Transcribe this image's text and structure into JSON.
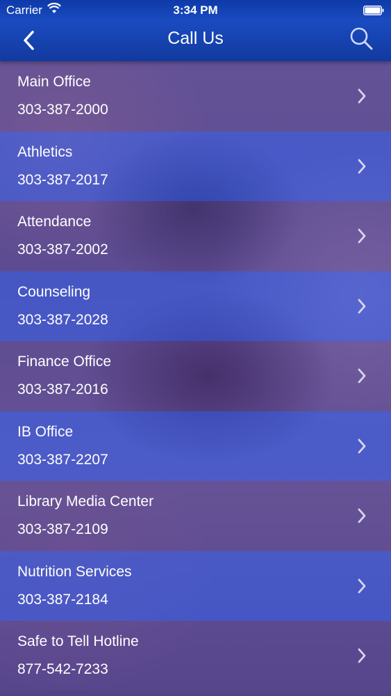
{
  "status_bar": {
    "carrier": "Carrier",
    "time": "3:34 PM"
  },
  "nav": {
    "title": "Call Us",
    "back_icon": "chevron-left-icon",
    "search_icon": "search-icon"
  },
  "contacts": [
    {
      "name": "Main Office",
      "phone": "303-387-2000"
    },
    {
      "name": "Athletics",
      "phone": "303-387-2017"
    },
    {
      "name": "Attendance",
      "phone": "303-387-2002"
    },
    {
      "name": "Counseling",
      "phone": "303-387-2028"
    },
    {
      "name": "Finance Office",
      "phone": "303-387-2016"
    },
    {
      "name": "IB Office",
      "phone": "303-387-2207"
    },
    {
      "name": "Library Media Center",
      "phone": "303-387-2109"
    },
    {
      "name": "Nutrition Services",
      "phone": "303-387-2184"
    },
    {
      "name": "Safe to Tell Hotline",
      "phone": "877-542-7233"
    }
  ],
  "colors": {
    "nav_bar": "#1a4bc0",
    "row_light": "#3a5ce6",
    "row_dark": "#624896"
  }
}
